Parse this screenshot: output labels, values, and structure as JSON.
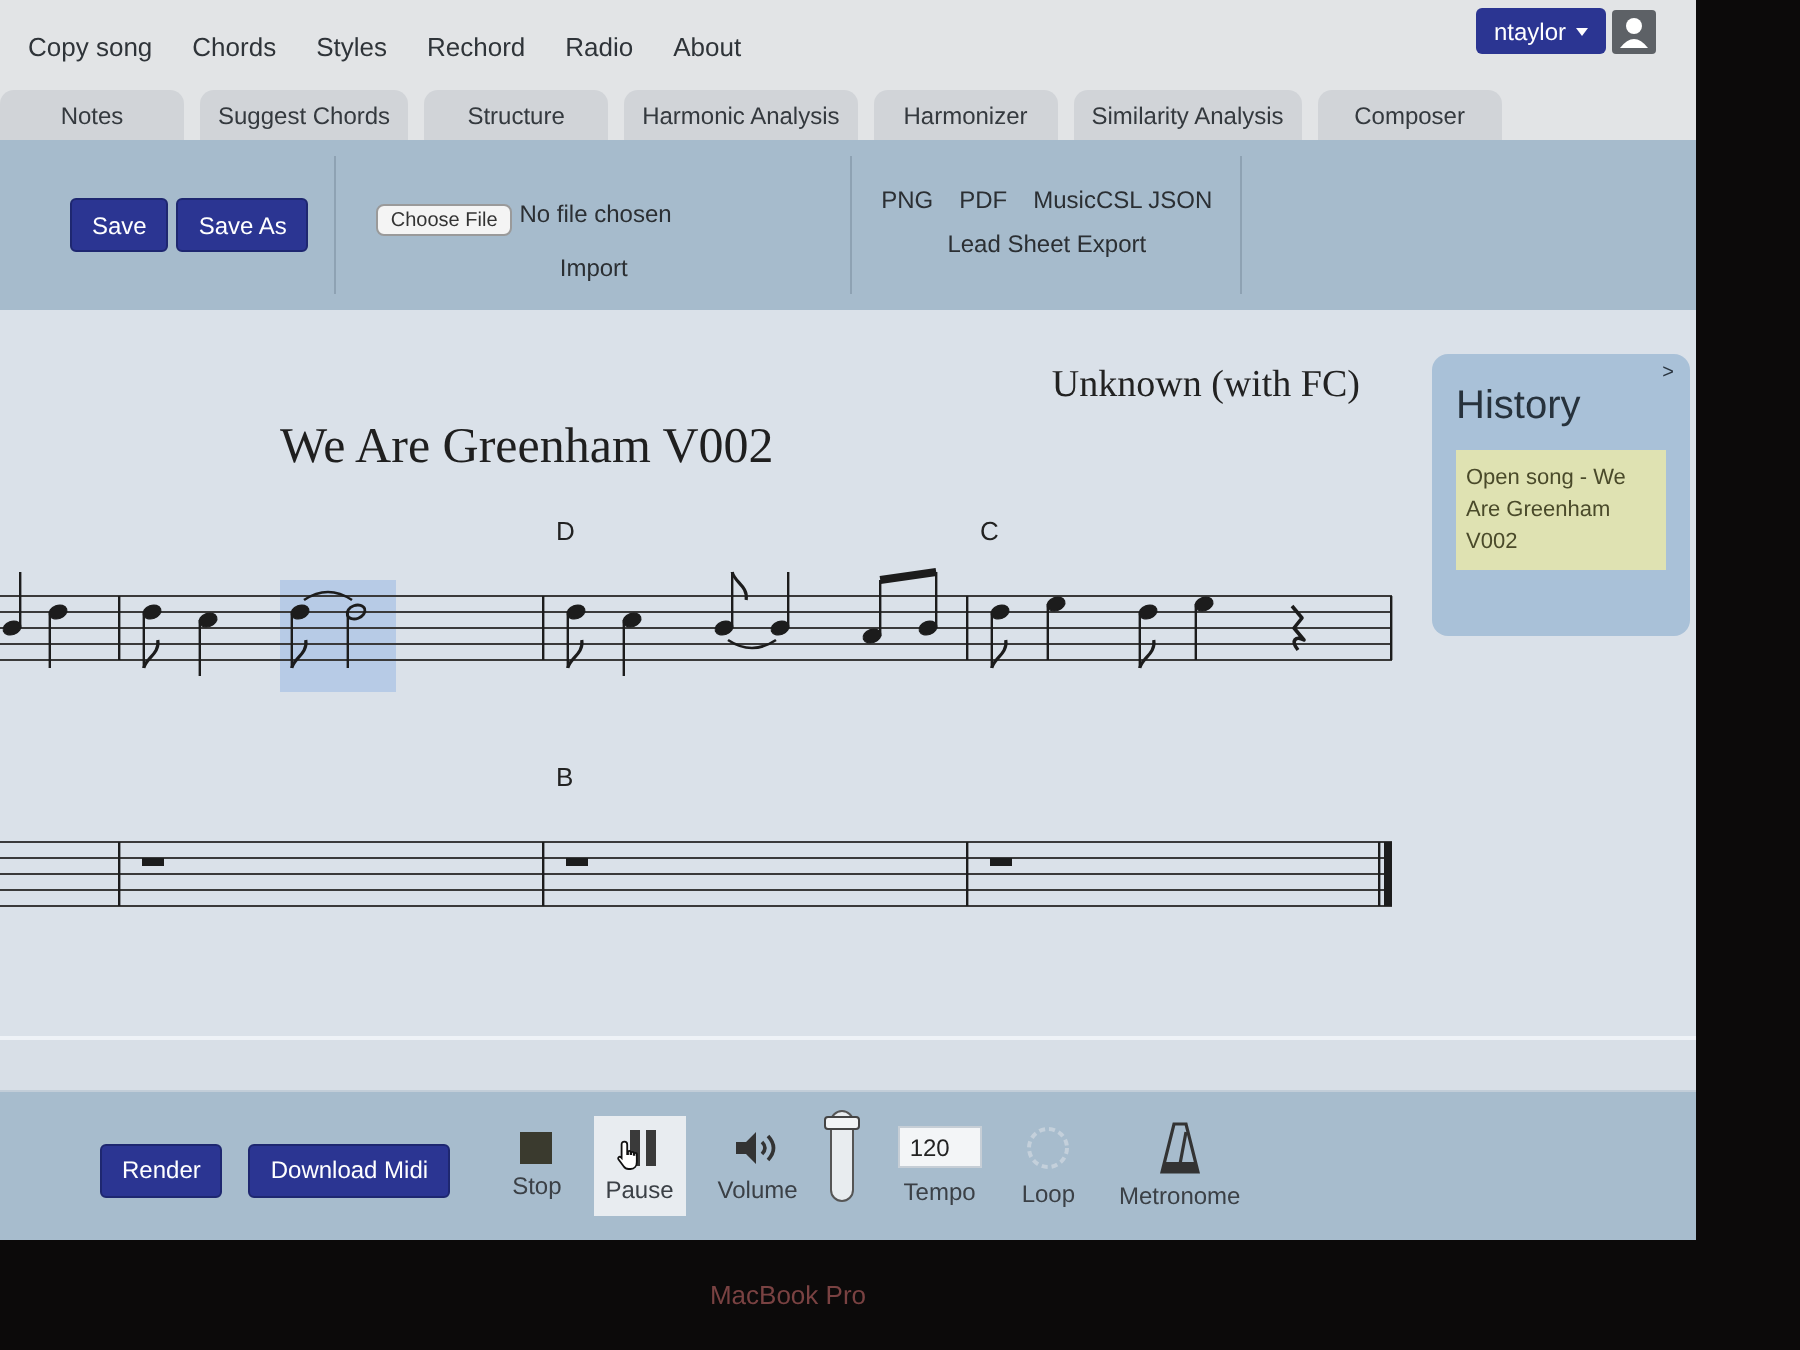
{
  "menu_bar": {
    "items": [
      "Copy song",
      "Chords",
      "Styles",
      "Rechord",
      "Radio",
      "About"
    ],
    "user": "ntaylor"
  },
  "tabs": [
    {
      "label": "Notes",
      "selected": false
    },
    {
      "label": "Suggest Chords",
      "selected": false
    },
    {
      "label": "Structure",
      "selected": false
    },
    {
      "label": "Harmonic Analysis",
      "selected": false
    },
    {
      "label": "Harmonizer",
      "selected": false
    },
    {
      "label": "Similarity Analysis",
      "selected": false
    },
    {
      "label": "Composer",
      "selected": false
    }
  ],
  "toolbar": {
    "buttons": [
      "Save",
      "Save As"
    ],
    "import": {
      "button": "Choose File",
      "status": "No file chosen",
      "caption": "Import"
    },
    "export": {
      "links": [
        "PNG",
        "PDF",
        "MusicCSL JSON"
      ],
      "caption": "Lead Sheet Export"
    }
  },
  "score": {
    "composer": "Unknown (with FC)",
    "title": "We Are Greenham V002",
    "staves": [
      {
        "final_barline": false,
        "measures": [
          {
            "kind": "partial",
            "notes": [
              {
                "kind": "quarter_b4",
                "tie": false,
                "beam": false,
                "selected": false
              },
              {
                "kind": "quarter_d5",
                "tie": false,
                "beam": false,
                "selected": false
              }
            ]
          },
          {
            "kind": "full",
            "notes": [
              {
                "kind": "eighth_d5",
                "tie": false,
                "beam": false,
                "selected": false
              },
              {
                "kind": "quarter_c5",
                "tie": false,
                "beam": false,
                "selected": false
              },
              {
                "kind": "eighth_d5",
                "tie": true,
                "beam": false,
                "selected": true
              },
              {
                "kind": "half_d5",
                "tie": false,
                "beam": false,
                "selected": true
              }
            ]
          },
          {
            "kind": "full",
            "chord": "D",
            "notes": [
              {
                "kind": "eighth_d5",
                "tie": false,
                "beam": false,
                "selected": false
              },
              {
                "kind": "quarter_c5",
                "tie": false,
                "beam": false,
                "selected": false
              },
              {
                "kind": "eighth_b4",
                "tie": true,
                "beam": false,
                "selected": false
              },
              {
                "kind": "quarter_b4",
                "tie": false,
                "beam": false,
                "selected": false
              },
              {
                "kind": "eighth_a4",
                "tie": false,
                "beam": true,
                "selected": false
              },
              {
                "kind": "eighth_b4",
                "tie": false,
                "beam": false,
                "selected": false
              }
            ]
          },
          {
            "kind": "full",
            "chord": "C",
            "notes": [
              {
                "kind": "eighth_d5",
                "tie": false,
                "beam": false,
                "selected": false
              },
              {
                "kind": "quarter_e5",
                "tie": false,
                "beam": false,
                "selected": false
              },
              {
                "kind": "eighth_d5",
                "tie": false,
                "beam": false,
                "selected": false
              },
              {
                "kind": "quarter_e5",
                "tie": false,
                "beam": false,
                "selected": false
              },
              {
                "kind": "rest_quarter",
                "tie": false,
                "beam": false,
                "selected": false
              }
            ]
          }
        ]
      },
      {
        "final_barline": true,
        "measures": [
          {
            "kind": "partial"
          },
          {
            "kind": "full",
            "notes": [
              {
                "kind": "rest_whole",
                "tie": false,
                "beam": false,
                "selected": false
              }
            ]
          },
          {
            "kind": "full",
            "chord": "B",
            "notes": [
              {
                "kind": "rest_whole",
                "tie": false,
                "beam": false,
                "selected": false
              }
            ]
          },
          {
            "kind": "full",
            "notes": [
              {
                "kind": "rest_whole",
                "tie": false,
                "beam": false,
                "selected": false
              }
            ]
          }
        ]
      }
    ]
  },
  "history": {
    "toggle": ">",
    "title": "History",
    "entries": [
      "Open song - We Are Greenham V002"
    ]
  },
  "player": {
    "buttons": [
      "Render",
      "Download Midi"
    ],
    "controls": [
      {
        "kind": "stop",
        "label": "Stop",
        "highlighted": false
      },
      {
        "kind": "pause",
        "label": "Pause",
        "highlighted": true
      },
      {
        "kind": "volume",
        "label": "Volume",
        "highlighted": false
      }
    ],
    "volume_slider": {
      "level": 0.95
    },
    "tempo": {
      "value": "120",
      "label": "Tempo"
    },
    "loop": {
      "label": "Loop",
      "on": false
    },
    "metronome": {
      "label": "Metronome"
    }
  },
  "bezel_label": "MacBook Pro"
}
